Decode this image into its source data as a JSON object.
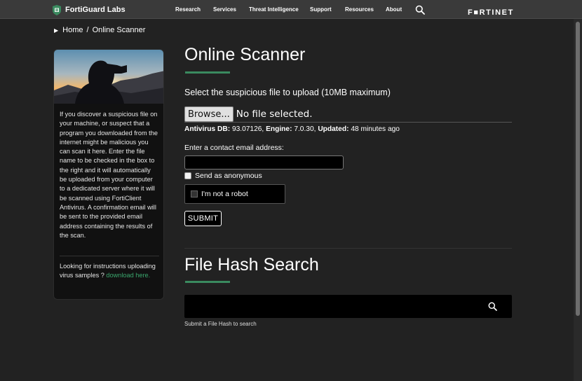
{
  "header": {
    "brand": "FortiGuard Labs",
    "nav": [
      "Research",
      "Services",
      "Threat Intelligence",
      "Support",
      "Resources",
      "About"
    ],
    "logo": "F■RTINET",
    "brand_color": "#3a8a5f"
  },
  "breadcrumb": {
    "home": "Home",
    "separator": "/",
    "current": "Online Scanner"
  },
  "sidebar": {
    "image_alt": "silhouette-with-binoculars",
    "description": "If you discover a suspicious file on your machine, or suspect that a program you downloaded from the internet might be malicious you can scan it here. Enter the file name to be checked in the box to the right and it will automatically be uploaded from your computer to a dedicated server where it will be scanned using FortiClient Antivirus. A confirmation email will be sent to the provided email address containing the results of the scan.",
    "help_text": "Looking for instructions uploading virus samples ?",
    "help_link": "download here."
  },
  "scanner": {
    "title": "Online Scanner",
    "upload_prompt": "Select the suspicious file to upload (10MB maximum)",
    "browse_label": "Browse...",
    "file_status": "No file selected.",
    "av_db_label": "Antivirus DB:",
    "av_db_value": "93.07126,",
    "engine_label": "Engine:",
    "engine_value": "7.0.30,",
    "updated_label": "Updated:",
    "updated_value": "48 minutes ago",
    "email_label": "Enter a contact email address:",
    "email_value": "",
    "anonymous_label": "Send as anonymous",
    "captcha_label": "I'm not a robot",
    "submit_label": "SUBMIT"
  },
  "hash_search": {
    "title": "File Hash Search",
    "input_value": "",
    "caption": "Submit a File Hash to search"
  }
}
